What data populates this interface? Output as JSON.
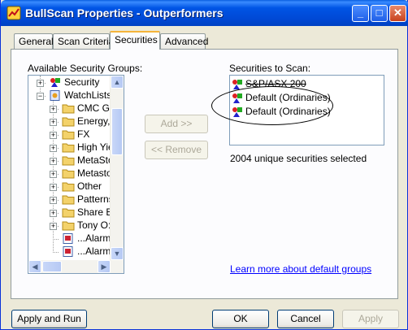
{
  "window": {
    "title": "BullScan Properties - Outperformers",
    "minimize_label": "_",
    "maximize_label": "□",
    "close_label": "✕"
  },
  "tabs": [
    {
      "label": "General",
      "active": false
    },
    {
      "label": "Scan Criteria",
      "active": false
    },
    {
      "label": "Securities",
      "active": true
    },
    {
      "label": "Advanced",
      "active": false
    }
  ],
  "available": {
    "label": "Available Security Groups:",
    "tree": [
      {
        "label": "Security",
        "icon": "security-group-icon",
        "expander": "+"
      },
      {
        "label": "WatchLists",
        "icon": "watchlist-icon",
        "expander": "−"
      },
      {
        "label": "CMC Gr",
        "icon": "folder-icon",
        "expander": "+"
      },
      {
        "label": "Energy,",
        "icon": "folder-icon",
        "expander": "+"
      },
      {
        "label": "FX",
        "icon": "folder-icon",
        "expander": "+"
      },
      {
        "label": "High Yie",
        "icon": "folder-icon",
        "expander": "+"
      },
      {
        "label": "MetaSto",
        "icon": "folder-icon",
        "expander": "+"
      },
      {
        "label": "Metasto",
        "icon": "folder-icon",
        "expander": "+"
      },
      {
        "label": "Other",
        "icon": "folder-icon",
        "expander": "+"
      },
      {
        "label": "Patterns",
        "icon": "folder-icon",
        "expander": "+"
      },
      {
        "label": "Share B",
        "icon": "folder-icon",
        "expander": "+"
      },
      {
        "label": "Tony O:",
        "icon": "folder-icon",
        "expander": "+"
      },
      {
        "label": "...Alarm",
        "icon": "alarm-list-icon",
        "expander": ""
      },
      {
        "label": "...Alarm",
        "icon": "alarm-list-icon",
        "expander": ""
      }
    ]
  },
  "buttons": {
    "add": "Add >>",
    "remove": "<< Remove",
    "apply_and_run": "Apply and Run",
    "ok": "OK",
    "cancel": "Cancel",
    "apply": "Apply"
  },
  "scan": {
    "label": "Securities to Scan:",
    "items": [
      {
        "label": "S&P/ASX 200",
        "strikethrough": true
      },
      {
        "label": "Default (Ordinaries)",
        "strikethrough": false
      },
      {
        "label": "Default (Ordinaries)",
        "strikethrough": false
      }
    ],
    "count_text": "2004 unique securities selected"
  },
  "link_text": "Learn more about default groups",
  "colors": {
    "title_bar": "#0055e5",
    "dialog_bg": "#ece9d8",
    "active_tab_accent": "#f5b43b",
    "link": "#0000ff",
    "folder": "#f3d26a"
  }
}
